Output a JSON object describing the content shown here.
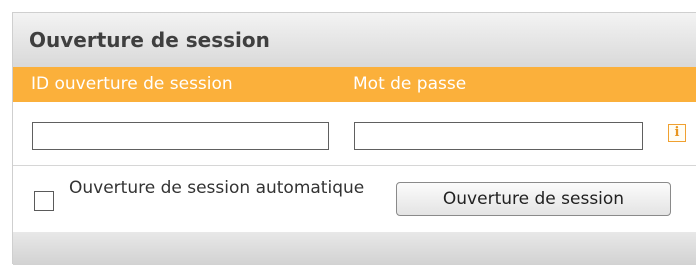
{
  "panel": {
    "title": "Ouverture de session",
    "labels": {
      "user_id": "ID ouverture de session",
      "password": "Mot de passe"
    },
    "fields": {
      "user_id_value": "",
      "password_value": ""
    },
    "info_icon": {
      "name": "info-icon",
      "glyph": "i"
    },
    "auto_login": {
      "checked": false,
      "label": "Ouverture de session automatique"
    },
    "login_button": "Ouverture de session"
  },
  "colors": {
    "accent_bar": "#fbb03b",
    "label_text": "#ffffff",
    "title_text": "#3f3f3f"
  }
}
